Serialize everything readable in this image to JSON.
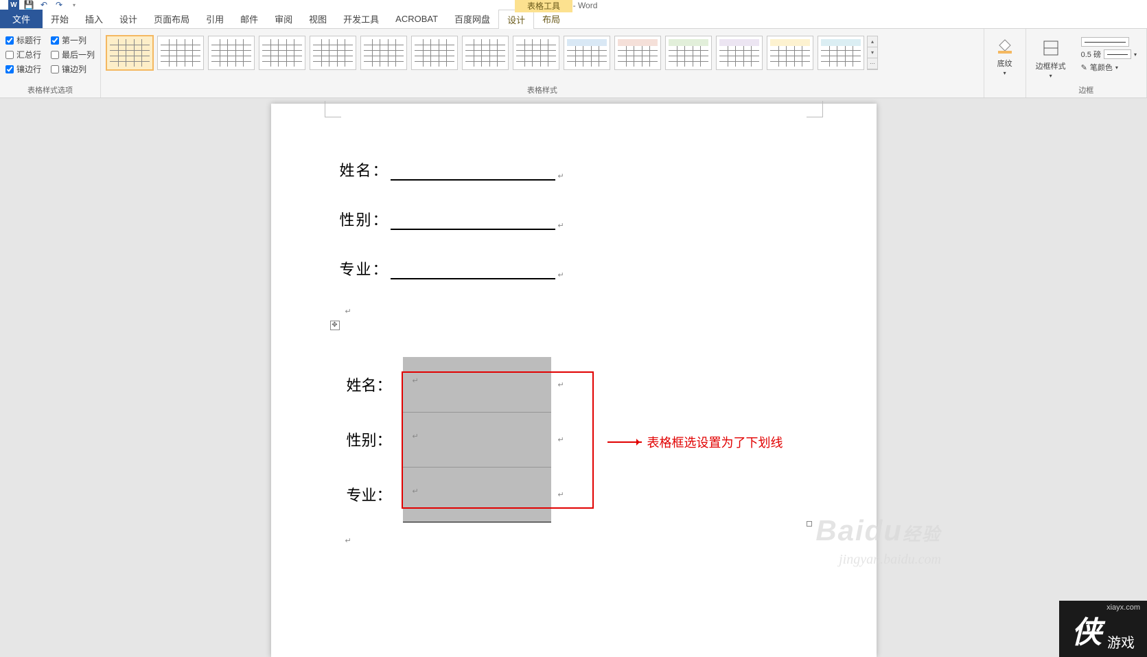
{
  "app": {
    "title": "文档1 - Word",
    "tabletools": "表格工具"
  },
  "qat": {
    "save": "save",
    "undo": "undo",
    "redo": "redo"
  },
  "tabs": {
    "file": "文件",
    "home": "开始",
    "insert": "插入",
    "design": "设计",
    "layout": "页面布局",
    "ref": "引用",
    "mail": "邮件",
    "review": "审阅",
    "view": "视图",
    "dev": "开发工具",
    "acrobat": "ACROBAT",
    "baidu": "百度网盘",
    "tdesign": "设计",
    "tlayout": "布局"
  },
  "styleopts": {
    "header_row": "标题行",
    "first_col": "第一列",
    "total_row": "汇总行",
    "last_col": "最后一列",
    "banded_row": "镶边行",
    "banded_col": "镶边列",
    "group_label": "表格样式选项"
  },
  "gallery": {
    "group_label": "表格样式"
  },
  "shading": {
    "label": "底纹"
  },
  "borderstyle": {
    "label": "边框样式",
    "weight": "0.5 磅",
    "pencolor": "笔颜色",
    "group_label": "边框"
  },
  "doc": {
    "fields": {
      "name": "姓名：",
      "gender": "性别：",
      "major": "专业："
    },
    "callout": "表格框选设置为了下划线"
  },
  "watermark": {
    "baidu": "Baidu",
    "jingyan": "经验",
    "url": "jingyan.baidu.com",
    "xia": "侠",
    "game": "游戏",
    "xiaurl": "xiayx.com"
  },
  "style_accents": [
    "#ffffff",
    "#ffffff",
    "#ffffff",
    "#ffffff",
    "#ffffff",
    "#ffffff",
    "#ffffff",
    "#ffffff",
    "#ffffff",
    "#d9e8f5",
    "#f5e0d9",
    "#e2efda",
    "#ece5f2",
    "#fdf2d0",
    "#dbeef3",
    "#f2dcdb"
  ]
}
